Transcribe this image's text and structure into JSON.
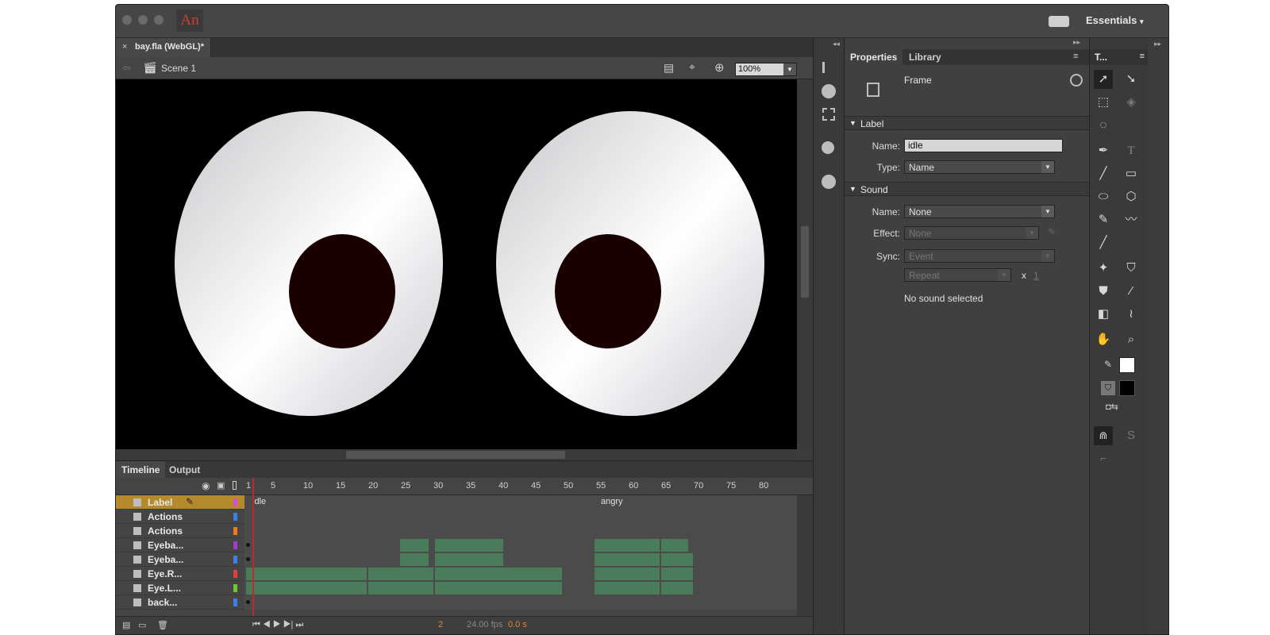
{
  "app": {
    "logo": "An",
    "workspace": "Essentials",
    "sync_icon": "sync-settings-icon"
  },
  "document": {
    "tab_title": "bay.fla (WebGL)*",
    "close": "×"
  },
  "editbar": {
    "scene": "Scene 1",
    "zoom": "100%"
  },
  "timeline": {
    "tabs": [
      "Timeline",
      "Output"
    ],
    "frame_numbers": [
      "1",
      "5",
      "10",
      "15",
      "20",
      "25",
      "30",
      "35",
      "40",
      "45",
      "50",
      "55",
      "60",
      "65",
      "70",
      "75",
      "80"
    ],
    "labels_on_frames": {
      "idle": "idle",
      "angry": "angry"
    },
    "layers": [
      {
        "name": "Label",
        "color": "#d94fd0",
        "highlighted": true
      },
      {
        "name": "Actions",
        "color": "#3d7ee8"
      },
      {
        "name": "Actions",
        "color": "#f07b1a"
      },
      {
        "name": "Eyeba...",
        "color": "#9b3fd2"
      },
      {
        "name": "Eyeba...",
        "color": "#3d7ee8"
      },
      {
        "name": "Eye.R...",
        "color": "#e33f3f"
      },
      {
        "name": "Eye.L...",
        "color": "#6cc82c"
      },
      {
        "name": "back...",
        "color": "#3d7ee8"
      }
    ],
    "status": {
      "frame": "2",
      "fps": "24.00 fps",
      "time": "0.0 s"
    }
  },
  "properties": {
    "tabs": [
      "Properties",
      "Library"
    ],
    "object_type": "Frame",
    "label_section": "Label",
    "label_name_label": "Name:",
    "label_name_value": "idle",
    "label_type_label": "Type:",
    "label_type_value": "Name",
    "sound_section": "Sound",
    "sound_name_label": "Name:",
    "sound_name_value": "None",
    "effect_label": "Effect:",
    "effect_value": "None",
    "sync_label": "Sync:",
    "sync_value": "Event",
    "repeat_value": "Repeat",
    "repeat_x": "x",
    "repeat_count": "1",
    "no_sound": "No sound selected"
  },
  "tools": {
    "header": "T...",
    "stroke_color": "#ffffff",
    "fill_color": "#000000"
  }
}
